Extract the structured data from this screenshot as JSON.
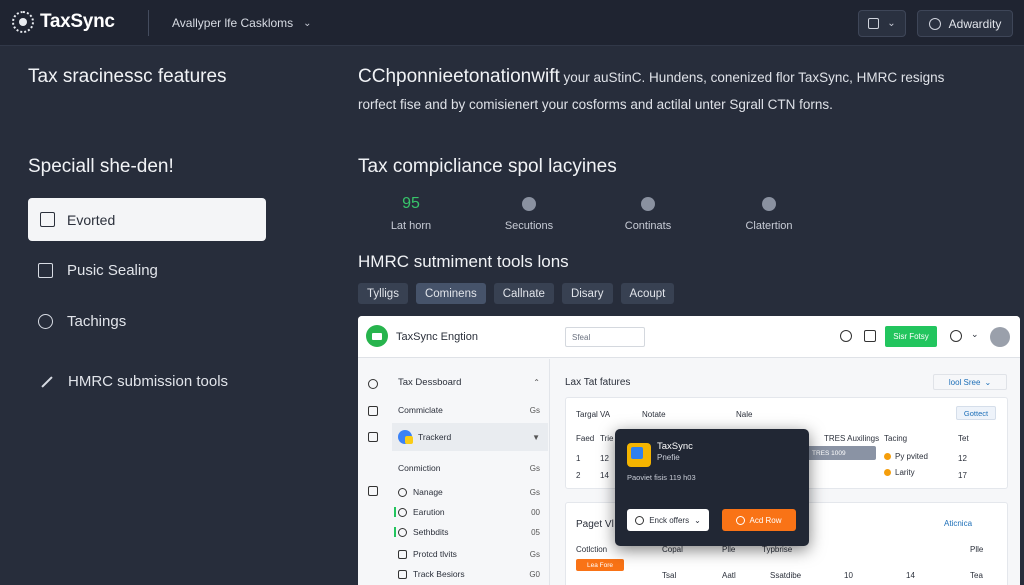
{
  "header": {
    "logo_text": "TaxSync",
    "menu_label": "Avallyper lfe Caskloms",
    "btn1_label": "",
    "btn2_label": "Adwardity"
  },
  "left": {
    "title": "Tax sracinessc features",
    "subtitle": "Speciall she-den!",
    "nav": [
      {
        "label": "Evorted",
        "icon": "lock-icon"
      },
      {
        "label": "Pusic Sealing",
        "icon": "checkbox-icon"
      },
      {
        "label": "Tachings",
        "icon": "info-icon"
      },
      {
        "label": "HMRC submission tools",
        "icon": "pen-icon"
      }
    ]
  },
  "hero": {
    "line1_big": "CChponnieetonationwift",
    "line1_small": " your auStinC. Hundens, conenized flor TaxSync, HMRC resigns",
    "line2": "rorfect fise and by comisienert your cosforms and actilal unter Sgrall CTN forns."
  },
  "compliance": {
    "title": "Tax compicliance spol lacyines",
    "stats": [
      {
        "value": "95",
        "label": "Lat horn"
      },
      {
        "value": "",
        "label": "Secutions"
      },
      {
        "value": "",
        "label": "Continats"
      },
      {
        "value": "",
        "label": "Clatertion"
      }
    ]
  },
  "tools": {
    "title": "HMRC sutmiment tools lons",
    "chips": [
      "Tylligs",
      "Cominens",
      "Callnate",
      "Disary",
      "Acoupt"
    ]
  },
  "app": {
    "name": "TaxSync Engtion",
    "search_placeholder": "Sfeal",
    "cta": "Sisr Fotsy",
    "sidebar": [
      {
        "label": "Tax Dessboard",
        "num": ""
      },
      {
        "label": "Commiclate",
        "num": "Gs"
      },
      {
        "label": "Trackerd",
        "num": ""
      },
      {
        "label": "Conmiction",
        "num": "Gs"
      },
      {
        "label": "Nanage",
        "num": "Gs"
      },
      {
        "label": "Earution",
        "num": "00"
      },
      {
        "label": "Sethbdits",
        "num": "05"
      },
      {
        "label": "Protcd tlvits",
        "num": "Gs"
      },
      {
        "label": "Track Besiors",
        "num": "G0"
      }
    ],
    "main_title": "Lax Tat fatures",
    "main_select": "lool Sree",
    "card1": {
      "col_a": "Targal VA",
      "col_b": "Notate",
      "col_c": "Nale",
      "button": "Gottect",
      "headers": [
        "Faed",
        "Trie",
        "TRES Auxilings",
        "Tacing",
        "Tet"
      ],
      "row1": [
        "1",
        "12"
      ],
      "row2": [
        "2",
        "14"
      ],
      "pill": "TRES 1009",
      "status1": "Py pvited",
      "status2": "Larity",
      "val1": "12",
      "val2": "17"
    },
    "card2": {
      "title": "Paget Vl",
      "link": "Aticnica",
      "label": "Cotlction",
      "button": "Lea Fore",
      "col1": "Copal",
      "col2": "Plle",
      "col3": "Typbrise",
      "col4": "Plle",
      "row": [
        "Tsal",
        "Aatl",
        "Ssatdibe",
        "10",
        "14",
        "Tea"
      ]
    }
  },
  "popup": {
    "title": "TaxSync",
    "sub": "Pnefie",
    "desc": "Paoviet fisis 119 h03",
    "btn_left": "Enck offers",
    "btn_right": "Acd Row"
  }
}
